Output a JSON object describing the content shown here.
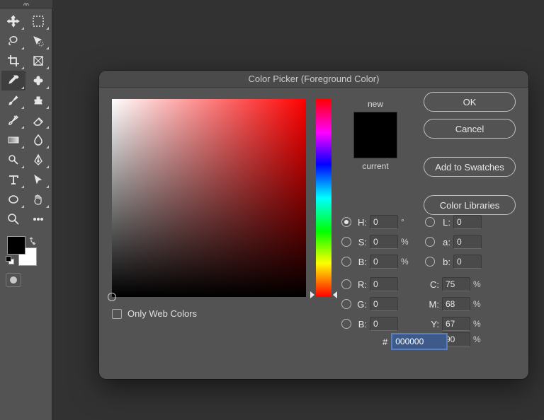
{
  "toolbar": {
    "tools": [
      {
        "name": "move-icon"
      },
      {
        "name": "marquee-icon"
      },
      {
        "name": "lasso-icon"
      },
      {
        "name": "quick-select-icon"
      },
      {
        "name": "crop-icon"
      },
      {
        "name": "frame-icon"
      },
      {
        "name": "eyedropper-icon"
      },
      {
        "name": "healing-brush-icon"
      },
      {
        "name": "brush-icon"
      },
      {
        "name": "clone-stamp-icon"
      },
      {
        "name": "history-brush-icon"
      },
      {
        "name": "eraser-icon"
      },
      {
        "name": "gradient-icon"
      },
      {
        "name": "blur-icon"
      },
      {
        "name": "dodge-icon"
      },
      {
        "name": "pen-icon"
      },
      {
        "name": "type-icon"
      },
      {
        "name": "path-select-icon"
      },
      {
        "name": "shape-icon"
      },
      {
        "name": "hand-icon"
      },
      {
        "name": "zoom-icon"
      },
      {
        "name": "more-icon"
      }
    ],
    "selected_index": 6,
    "fg_color": "#000000",
    "bg_color": "#ffffff"
  },
  "dialog": {
    "title": "Color Picker (Foreground Color)",
    "buttons": {
      "ok": "OK",
      "cancel": "Cancel",
      "add_swatch": "Add to Swatches",
      "libraries": "Color Libraries"
    },
    "new_label": "new",
    "current_label": "current",
    "new_color": "#000000",
    "current_color": "#000000",
    "only_web_colors_label": "Only Web Colors",
    "only_web_colors_checked": false,
    "hue_base": "#ff0000",
    "selected_model": "H",
    "values": {
      "H": {
        "value": "0",
        "unit": "°"
      },
      "S": {
        "value": "0",
        "unit": "%"
      },
      "Bv": {
        "value": "0",
        "unit": "%"
      },
      "R": {
        "value": "0",
        "unit": ""
      },
      "G": {
        "value": "0",
        "unit": ""
      },
      "Bc": {
        "value": "0",
        "unit": ""
      },
      "L": {
        "value": "0",
        "unit": ""
      },
      "a": {
        "value": "0",
        "unit": ""
      },
      "bl": {
        "value": "0",
        "unit": ""
      },
      "C": {
        "value": "75",
        "unit": "%"
      },
      "M": {
        "value": "68",
        "unit": "%"
      },
      "Y": {
        "value": "67",
        "unit": "%"
      },
      "K": {
        "value": "90",
        "unit": "%"
      }
    },
    "hex": "000000"
  }
}
